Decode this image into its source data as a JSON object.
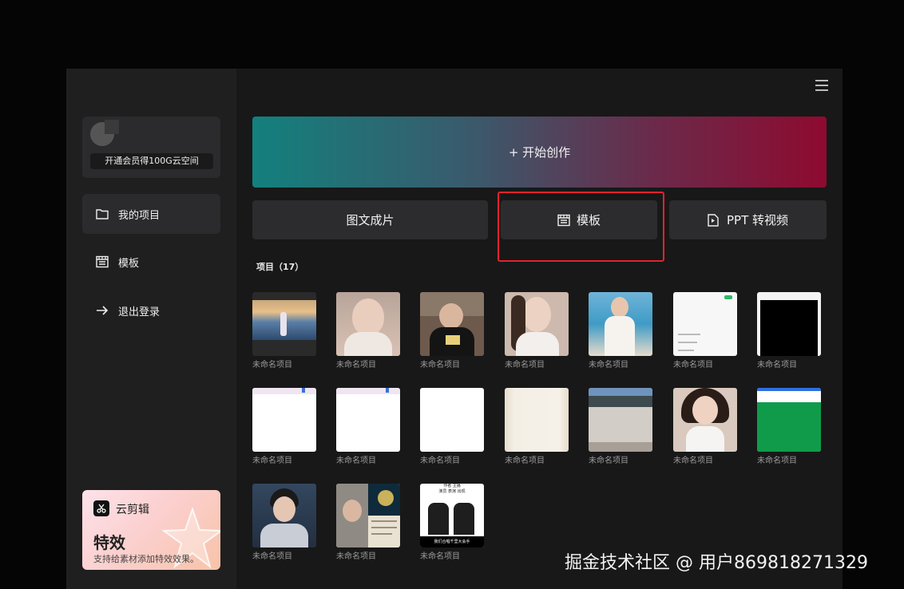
{
  "profile": {
    "vip_text": "开通会员得100G云空间"
  },
  "sidebar": {
    "items": [
      {
        "label": "我的项目",
        "icon": "folder-icon"
      },
      {
        "label": "模板",
        "icon": "template-icon"
      },
      {
        "label": "退出登录",
        "icon": "arrow-right-icon"
      }
    ]
  },
  "promo": {
    "brand": "云剪辑",
    "title": "特效",
    "desc": "支持给素材添加特效效果。"
  },
  "hero": {
    "label": "+ 开始创作"
  },
  "tiles": [
    {
      "label": "图文成片"
    },
    {
      "label": "模板",
      "icon": "template-icon"
    },
    {
      "label": "PPT 转视频",
      "icon": "play-file-icon"
    }
  ],
  "projects": {
    "section_label": "项目（17）",
    "items": [
      {
        "name": "未命名项目"
      },
      {
        "name": "未命名项目"
      },
      {
        "name": "未命名项目"
      },
      {
        "name": "未命名项目"
      },
      {
        "name": "未命名项目"
      },
      {
        "name": "未命名项目"
      },
      {
        "name": "未命名项目"
      },
      {
        "name": "未命名项目"
      },
      {
        "name": "未命名项目"
      },
      {
        "name": "未命名项目"
      },
      {
        "name": "未命名项目"
      },
      {
        "name": "未命名项目"
      },
      {
        "name": "未命名项目"
      },
      {
        "name": "未命名项目"
      },
      {
        "name": "未命名项目"
      },
      {
        "name": "未命名项目"
      },
      {
        "name": "未命名项目"
      }
    ]
  },
  "thumb7_caption": [
    "作者 主播",
    "演员 表演 出现",
    "我们合唱千里大会手"
  ],
  "watermark": "掘金技术社区 @ 用户869818271329",
  "colors": {
    "highlight": "#e0232f",
    "hero_start": "#13807d",
    "hero_end": "#8e0a30"
  }
}
